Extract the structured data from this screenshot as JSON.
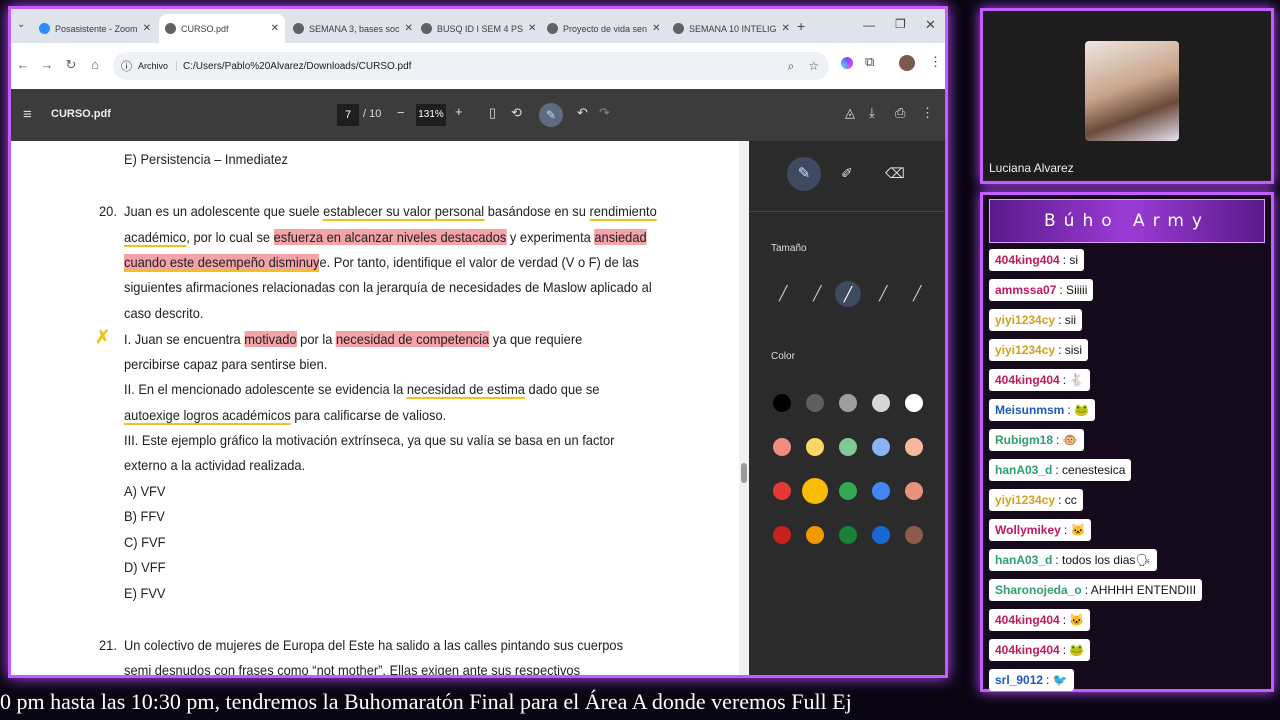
{
  "browser": {
    "tabs": [
      {
        "label": "Posasistente - Zoom",
        "active": false
      },
      {
        "label": "CURSO.pdf",
        "active": true
      },
      {
        "label": "SEMANA 3, bases soc",
        "active": false
      },
      {
        "label": "BUSQ ID I SEM 4 PS",
        "active": false
      },
      {
        "label": "Proyecto de vida sen",
        "active": false
      },
      {
        "label": "SEMANA 10 INTELIG",
        "active": false
      }
    ],
    "address_chip": "Archivo",
    "url": "C:/Users/Pablo%20Alvarez/Downloads/CURSO.pdf"
  },
  "pdf": {
    "filename": "CURSO.pdf",
    "page_current": "7",
    "page_total": "/ 10",
    "zoom": "131%",
    "lines": {
      "l0": "E) Persistencia – Inmediatez",
      "q20_num": "20.",
      "l1a": "Juan es un adolescente que suele ",
      "l1b": "establecer su valor personal",
      "l1c": " basándose en su ",
      "l1d": "rendimiento",
      "l2a": "académico",
      "l2b": ", por lo cual se ",
      "l2c": "esfuerza en alcanzar niveles destacados",
      "l2d": " y experimenta ",
      "l2e": "ansiedad",
      "l3a": "cuando este desempeño disminuy",
      "l3b": "e. Por tanto, identifique el valor de verdad (V o F) de las",
      "l4": "siguientes afirmaciones relacionadas con la jerarquía de necesidades de Maslow aplicado al",
      "l5": "caso descrito.",
      "l6a": "I. Juan se encuentra ",
      "l6b": "motivado",
      "l6c": " por la ",
      "l6d": "necesidad de competencia",
      "l6e": " ya que requiere",
      "l7": "percibirse capaz para sentirse bien.",
      "l8a": "II. En el mencionado adolescente se evidencia la ",
      "l8b": "necesidad de estima",
      "l8c": " dado que se",
      "l9a": "autoexige logros académicos",
      "l9b": " para calificarse de valioso.",
      "l10": "III. Este ejemplo gráfico la motivación extrínseca, ya que su valía se basa en un factor",
      "l11": "externo a la actividad realizada.",
      "oA": "A) VFV",
      "oB": "B) FFV",
      "oC": "C) FVF",
      "oD": "D) VFF",
      "oE": "E) FVV",
      "q21_num": "21.",
      "l21a": "Un colectivo de mujeres de Europa del Este ha salido a las calles pintando sus cuerpos",
      "l21b": "semi desnudos con frases como “not mother”. Ellas exigen ante sus respectivos"
    }
  },
  "annotation_panel": {
    "size_label": "Tamaño",
    "color_label": "Color",
    "colors": [
      "#000000",
      "#5f5f5f",
      "#9e9e9e",
      "#d6d6d6",
      "#ffffff",
      "#f28b82",
      "#fdd663",
      "#81c995",
      "#8ab4f8",
      "#f6b9a0",
      "#e53935",
      "#fbbc04",
      "#34a853",
      "#4285f4",
      "#e8917b",
      "#c5221f",
      "#f29900",
      "#188038",
      "#1967d2",
      "#8d5b4c"
    ]
  },
  "webcam": {
    "name": "Luciana Alvarez"
  },
  "chat": {
    "title": "Búho Army",
    "messages": [
      {
        "user": "404king404",
        "text": ": si",
        "color": "#c2185b"
      },
      {
        "user": "ammssa07",
        "text": ": Siiiii",
        "color": "#c2185b"
      },
      {
        "user": "yiyi1234cy",
        "text": ": sii",
        "color": "#d4a017"
      },
      {
        "user": "yiyi1234cy",
        "text": ": sisi",
        "color": "#d4a017"
      },
      {
        "user": "404king404",
        "text": ": 🐇",
        "color": "#c2185b"
      },
      {
        "user": "Meisunmsm",
        "text": ": 🐸",
        "color": "#1e5bb8"
      },
      {
        "user": "Rubigm18",
        "text": ": 🐵",
        "color": "#2e9e6e"
      },
      {
        "user": "hanA03_d",
        "text": ": cenestesica",
        "color": "#2e9e6e"
      },
      {
        "user": "yiyi1234cy",
        "text": ": cc",
        "color": "#d4a017"
      },
      {
        "user": "Wollymikey",
        "text": ": 🐱",
        "color": "#c2185b"
      },
      {
        "user": "hanA03_d",
        "text": ": todos los dias🗣",
        "color": "#2e9e6e"
      },
      {
        "user": "Sharonojeda_o",
        "text": ": AHHHH ENTENDIII",
        "color": "#2e9e6e"
      },
      {
        "user": "404king404",
        "text": ": 🐱",
        "color": "#c2185b"
      },
      {
        "user": "404king404",
        "text": ": 🐸",
        "color": "#c2185b"
      },
      {
        "user": "srl_9012",
        "text": ": 🐦",
        "color": "#1e5bb8"
      }
    ]
  },
  "ticker": "0 pm hasta las 10:30 pm, tendremos la Buhomaratón Final para el Área A donde veremos Full Ej"
}
